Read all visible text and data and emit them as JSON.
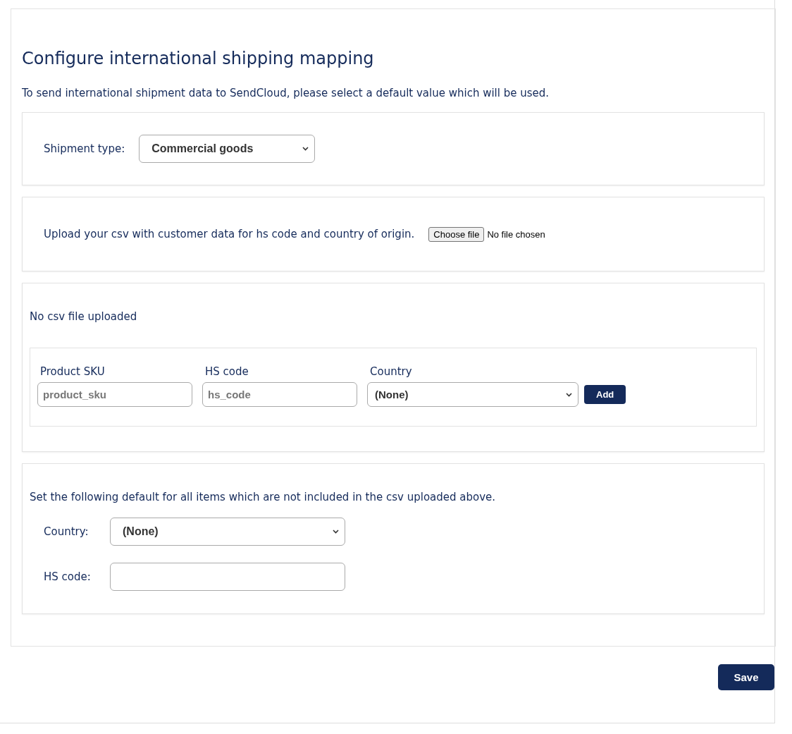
{
  "title": "Configure international shipping mapping",
  "intro": "To send international shipment data to SendCloud, please select a default value which will be used.",
  "shipment_type": {
    "label": "Shipment type:",
    "value": "Commercial goods"
  },
  "upload": {
    "label": "Upload your csv with customer data for hs code and country of origin.",
    "button": "Choose file",
    "status": "No file chosen"
  },
  "mapping": {
    "status": "No csv file uploaded",
    "fields": [
      {
        "kind": "input",
        "label": "Product SKU",
        "placeholder": "product_sku"
      },
      {
        "kind": "input",
        "label": "HS code",
        "placeholder": "hs_code"
      },
      {
        "kind": "select",
        "label": "Country",
        "value": "(None)"
      }
    ],
    "add_button": "Add"
  },
  "defaults": {
    "intro": "Set the following default for all items which are not included in the csv uploaded above.",
    "fields": [
      {
        "kind": "select",
        "label": "Country:",
        "value": "(None)"
      },
      {
        "kind": "input",
        "label": "HS code:"
      }
    ]
  },
  "save_button": "Save"
}
